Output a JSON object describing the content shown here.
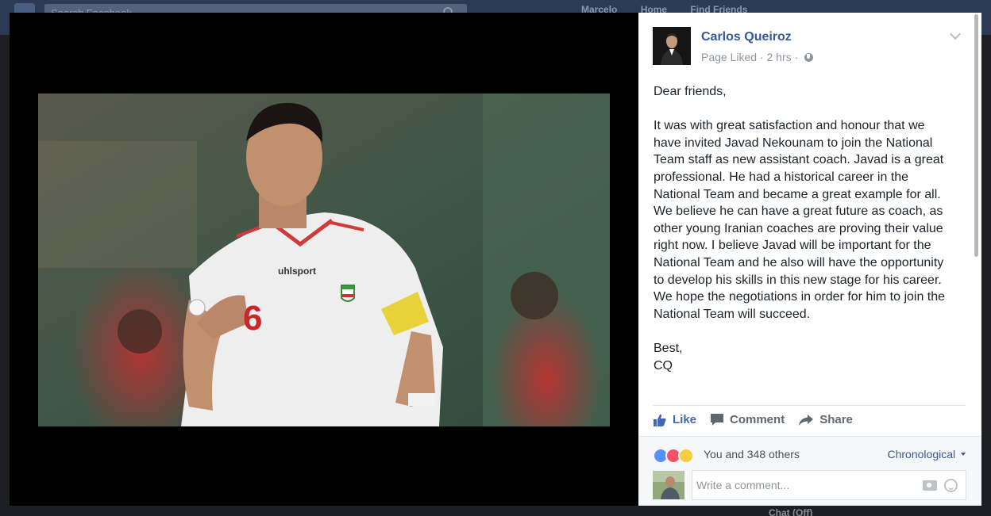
{
  "background": {
    "search_placeholder": "Search Facebook",
    "nav": [
      "Marcelo",
      "Home",
      "Find Friends"
    ],
    "chat_label": "Chat (Off)"
  },
  "photo": {
    "jersey_brand": "uhlsport",
    "jersey_number": "6"
  },
  "post": {
    "author": "Carlos Queiroz",
    "meta": "Page Liked · 2 hrs ·",
    "greeting": "Dear friends,",
    "paragraph_lines": [
      "It was with great satisfaction and honour that we",
      "have invited Javad Nekounam to join the National",
      "Team staff as new assistant coach. Javad is a great",
      "professional. He had a historical career in the",
      "National Team and became a great example for all.",
      "We believe he can have a great future as coach, as",
      "other young Iranian coaches are proving their value",
      "right now. I believe Javad will be important for the",
      "National Team and he also will have the opportunity",
      "to develop his skills in this new stage for his career.",
      "We hope the negotiations in order for him to join the",
      "National Team will succeed."
    ],
    "closing_1": "Best,",
    "closing_2": "CQ"
  },
  "actions": {
    "like": "Like",
    "comment": "Comment",
    "share": "Share"
  },
  "reactions": {
    "text": "You and 348 others",
    "sort": "Chronological",
    "icons": [
      "like-icon",
      "love-icon",
      "wow-icon"
    ]
  },
  "comment": {
    "placeholder": "Write a comment..."
  },
  "colors": {
    "link": "#365899",
    "like_blue": "#4267b2",
    "theater_bg": "#000000"
  }
}
